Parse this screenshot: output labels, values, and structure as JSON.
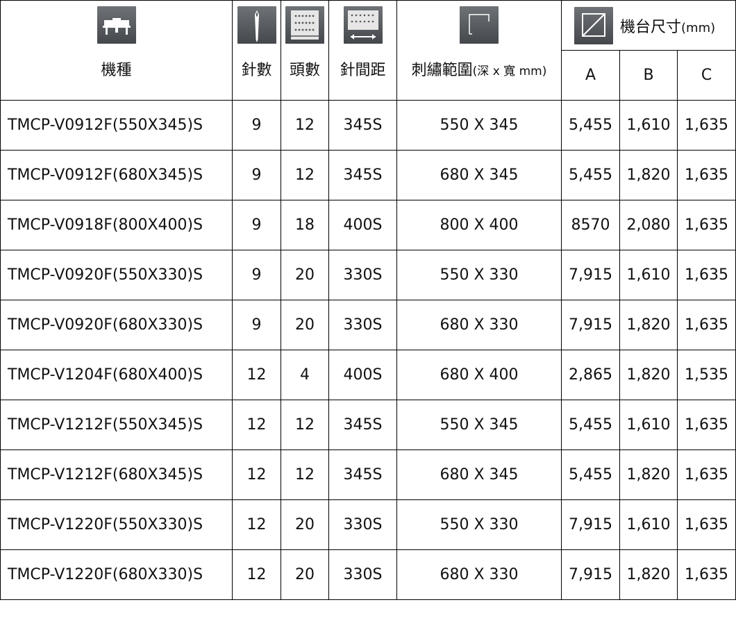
{
  "header": {
    "model": "機種",
    "needles": "針數",
    "heads": "頭數",
    "pitch": "針間距",
    "area_main": "刺繡範圍",
    "area_unit": "(深 x 寬 mm)",
    "dim_title": "機台尺寸",
    "dim_unit": "(mm)",
    "dim_a": "A",
    "dim_b": "B",
    "dim_c": "C",
    "icons": [
      "machine-icon",
      "needle-icon",
      "heads-icon",
      "head-pitch-icon",
      "embroidery-area-icon",
      "dimension-icon"
    ]
  },
  "rows": [
    {
      "model": "TMCP-V0912F(550X345)S",
      "needles": "9",
      "heads": "12",
      "pitch": "345S",
      "area": "550 X 345",
      "a": "5,455",
      "b": "1,610",
      "c": "1,635"
    },
    {
      "model": "TMCP-V0912F(680X345)S",
      "needles": "9",
      "heads": "12",
      "pitch": "345S",
      "area": "680 X 345",
      "a": "5,455",
      "b": "1,820",
      "c": "1,635"
    },
    {
      "model": "TMCP-V0918F(800X400)S",
      "needles": "9",
      "heads": "18",
      "pitch": "400S",
      "area": "800 X 400",
      "a": "8570",
      "b": "2,080",
      "c": "1,635"
    },
    {
      "model": "TMCP-V0920F(550X330)S",
      "needles": "9",
      "heads": "20",
      "pitch": "330S",
      "area": "550 X 330",
      "a": "7,915",
      "b": "1,610",
      "c": "1,635"
    },
    {
      "model": "TMCP-V0920F(680X330)S",
      "needles": "9",
      "heads": "20",
      "pitch": "330S",
      "area": "680 X 330",
      "a": "7,915",
      "b": "1,820",
      "c": "1,635"
    },
    {
      "model": "TMCP-V1204F(680X400)S",
      "needles": "12",
      "heads": "4",
      "pitch": "400S",
      "area": "680 X 400",
      "a": "2,865",
      "b": "1,820",
      "c": "1,535"
    },
    {
      "model": "TMCP-V1212F(550X345)S",
      "needles": "12",
      "heads": "12",
      "pitch": "345S",
      "area": "550 X 345",
      "a": "5,455",
      "b": "1,610",
      "c": "1,635"
    },
    {
      "model": "TMCP-V1212F(680X345)S",
      "needles": "12",
      "heads": "12",
      "pitch": "345S",
      "area": "680 X 345",
      "a": "5,455",
      "b": "1,820",
      "c": "1,635"
    },
    {
      "model": "TMCP-V1220F(550X330)S",
      "needles": "12",
      "heads": "20",
      "pitch": "330S",
      "area": "550 X 330",
      "a": "7,915",
      "b": "1,610",
      "c": "1,635"
    },
    {
      "model": "TMCP-V1220F(680X330)S",
      "needles": "12",
      "heads": "20",
      "pitch": "330S",
      "area": "680 X 330",
      "a": "7,915",
      "b": "1,820",
      "c": "1,635"
    }
  ]
}
